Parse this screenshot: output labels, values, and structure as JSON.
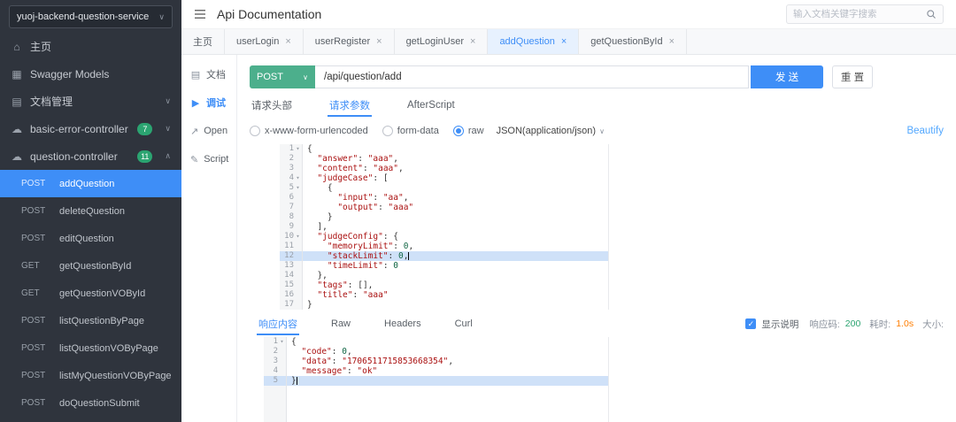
{
  "colors": {
    "primary": "#3e8ef7",
    "method": "#4caf8c",
    "status-ok": "#2ba471",
    "time": "#ff7d00",
    "sidebar-bg": "#2f343d",
    "active-line": "#cfe1f8"
  },
  "sidebar": {
    "service": "yuoj-backend-question-service",
    "nav_items": [
      {
        "key": "home",
        "label": "主页",
        "icon": "home-icon"
      },
      {
        "key": "swagger-models",
        "label": "Swagger Models",
        "icon": "models-icon"
      },
      {
        "key": "doc-manage",
        "label": "文档管理",
        "icon": "folder-icon",
        "chevron": "chevron-down-icon"
      },
      {
        "key": "basic-error-controller",
        "label": "basic-error-controller",
        "icon": "controller-icon",
        "badge": "7",
        "chevron": "chevron-down-icon"
      },
      {
        "key": "question-controller",
        "label": "question-controller",
        "icon": "controller-icon",
        "badge": "11",
        "chevron": "chevron-up-icon"
      }
    ],
    "endpoints": [
      {
        "method": "POST",
        "name": "addQuestion",
        "active": true
      },
      {
        "method": "POST",
        "name": "deleteQuestion"
      },
      {
        "method": "POST",
        "name": "editQuestion"
      },
      {
        "method": "GET",
        "name": "getQuestionById"
      },
      {
        "method": "GET",
        "name": "getQuestionVOById"
      },
      {
        "method": "POST",
        "name": "listQuestionByPage"
      },
      {
        "method": "POST",
        "name": "listQuestionVOByPage"
      },
      {
        "method": "POST",
        "name": "listMyQuestionVOByPage"
      },
      {
        "method": "POST",
        "name": "doQuestionSubmit"
      }
    ]
  },
  "header": {
    "title": "Api Documentation",
    "search_placeholder": "输入文档关键字搜索"
  },
  "tabs": [
    {
      "key": "home",
      "label": "主页",
      "closable": false
    },
    {
      "key": "userLogin",
      "label": "userLogin",
      "closable": true
    },
    {
      "key": "userRegister",
      "label": "userRegister",
      "closable": true
    },
    {
      "key": "getLoginUser",
      "label": "getLoginUser",
      "closable": true
    },
    {
      "key": "addQuestion",
      "label": "addQuestion",
      "closable": true,
      "active": true
    },
    {
      "key": "getQuestionById",
      "label": "getQuestionById",
      "closable": true
    }
  ],
  "doc_rail": [
    {
      "key": "doc",
      "label": "文档",
      "icon": "doc-icon"
    },
    {
      "key": "debug",
      "label": "调试",
      "icon": "debug-icon",
      "active": true
    },
    {
      "key": "open",
      "label": "Open",
      "icon": "open-icon"
    },
    {
      "key": "script",
      "label": "Script",
      "icon": "script-icon"
    }
  ],
  "request": {
    "method": "POST",
    "url": "/api/question/add",
    "send_label": "发 送",
    "reset_label": "重 置",
    "tabs": [
      {
        "key": "headers",
        "label": "请求头部"
      },
      {
        "key": "params",
        "label": "请求参数",
        "active": true
      },
      {
        "key": "afterscript",
        "label": "AfterScript"
      }
    ],
    "body_types": [
      {
        "key": "x-www-form-urlencoded",
        "label": "x-www-form-urlencoded"
      },
      {
        "key": "form-data",
        "label": "form-data"
      },
      {
        "key": "raw",
        "label": "raw",
        "selected": true
      }
    ],
    "content_type": "JSON(application/json)",
    "beautify_label": "Beautify",
    "active_line": 12,
    "body_lines": [
      "{",
      "  \"answer\": \"aaa\",",
      "  \"content\": \"aaa\",",
      "  \"judgeCase\": [",
      "    {",
      "      \"input\": \"aa\",",
      "      \"output\": \"aaa\"",
      "    }",
      "  ],",
      "  \"judgeConfig\": {",
      "    \"memoryLimit\": 0,",
      "    \"stackLimit\": 0,",
      "    \"timeLimit\": 0",
      "  },",
      "  \"tags\": [],",
      "  \"title\": \"aaa\"",
      "}"
    ]
  },
  "response": {
    "tabs": [
      {
        "key": "content",
        "label": "响应内容",
        "active": true
      },
      {
        "key": "raw",
        "label": "Raw"
      },
      {
        "key": "headers",
        "label": "Headers"
      },
      {
        "key": "curl",
        "label": "Curl"
      }
    ],
    "show_desc_label": "显示说明",
    "status_label": "响应码:",
    "status_value": "200",
    "time_label": "耗时:",
    "time_value": "1.0s",
    "size_label": "大小:",
    "active_line": 5,
    "body_lines": [
      "{",
      "  \"code\": 0,",
      "  \"data\": \"1706511715853668354\",",
      "  \"message\": \"ok\"",
      "}"
    ]
  }
}
